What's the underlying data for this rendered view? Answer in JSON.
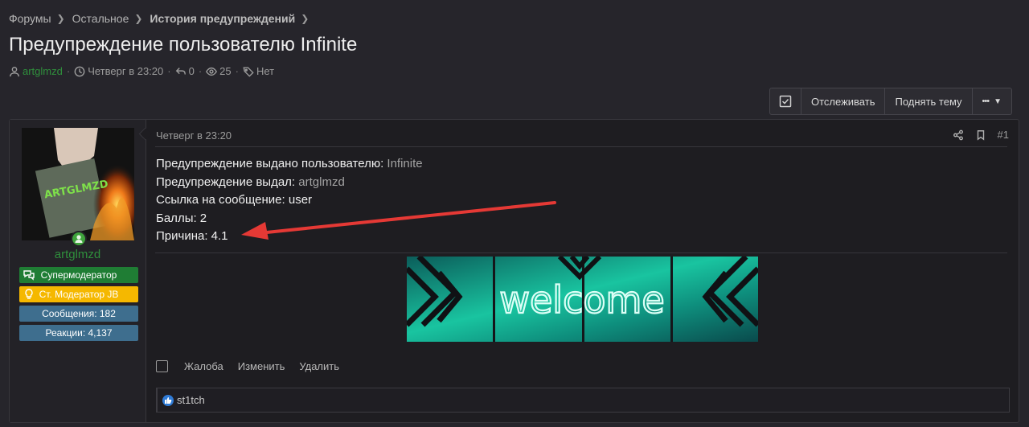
{
  "breadcrumb": [
    "Форумы",
    "Остальное",
    "История предупреждений"
  ],
  "title": "Предупреждение пользователю Infinite",
  "meta": {
    "author": "artglmzd",
    "date": "Четверг в 23:20",
    "replies": "0",
    "views": "25",
    "tags": "Нет"
  },
  "actions": {
    "watch": "Отслеживать",
    "bump": "Поднять тему",
    "more": "•••"
  },
  "post": {
    "date": "Четверг в 23:20",
    "number": "#1",
    "user": {
      "name": "artglmzd",
      "badges": [
        "Супермодератор",
        "Ст. Модератор JB",
        "Сообщения: 182",
        "Реакции: 4,137"
      ]
    },
    "lines": [
      {
        "label": "Предупреждение выдано пользователю: ",
        "value": "Infinite"
      },
      {
        "label": "Предупреждение выдал: ",
        "value": "artglmzd"
      },
      {
        "label": "Ссылка на сообщение: user",
        "value": ""
      },
      {
        "label": "Баллы: 2",
        "value": ""
      },
      {
        "label": "Причина: 4.1",
        "value": ""
      }
    ],
    "banner_text": "welcome",
    "avatar_text": "ARTGLMZD",
    "footer_actions": [
      "Жалоба",
      "Изменить",
      "Удалить"
    ],
    "reaction_user": "st1tch"
  },
  "colors": {
    "accent_green": "#2f8f3c",
    "badge_yellow": "#f5b800",
    "badge_blue": "#3e6e8e",
    "annotation_red": "#e53935"
  }
}
